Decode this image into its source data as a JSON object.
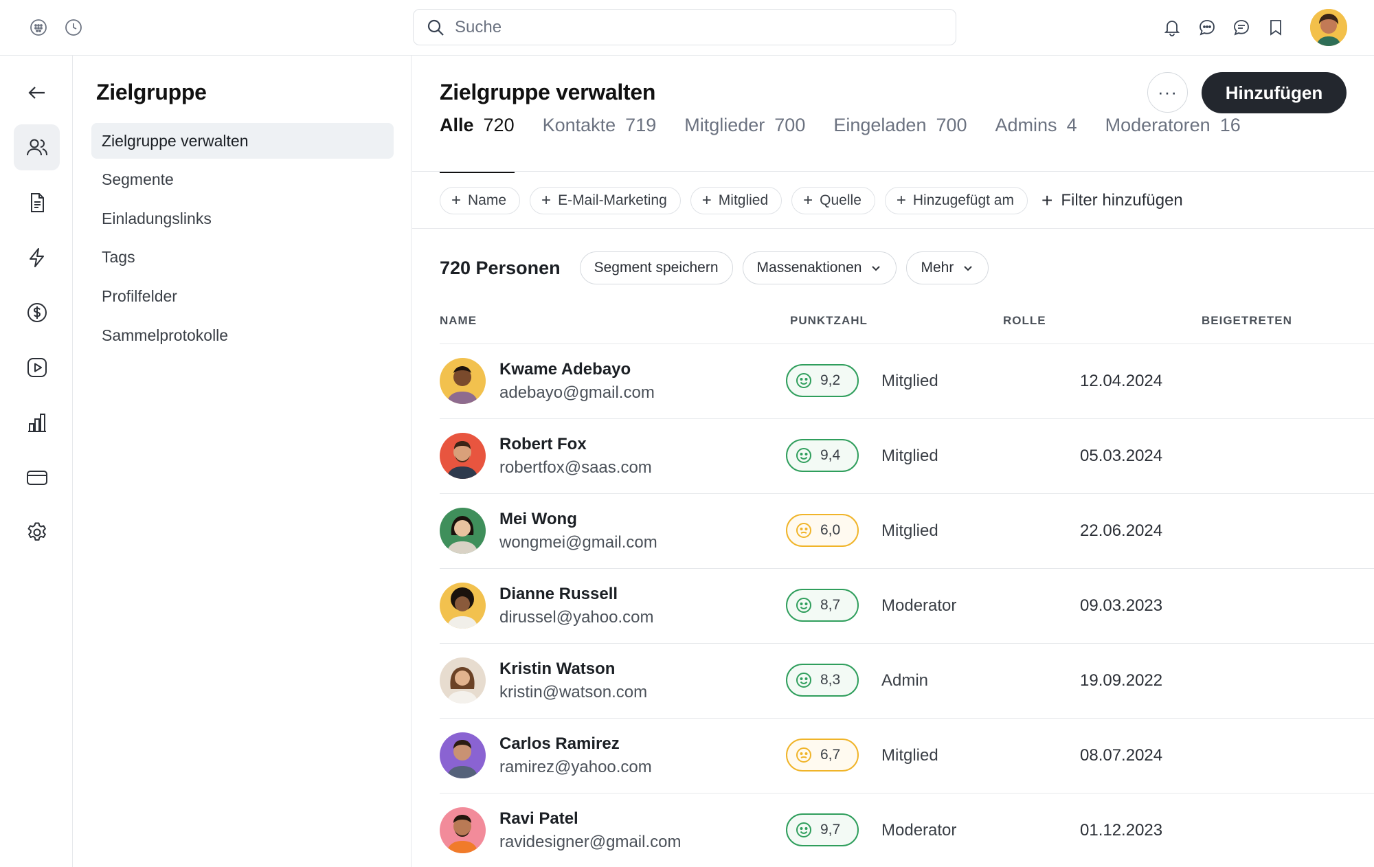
{
  "topbar": {
    "search_placeholder": "Suche",
    "left_icons": [
      "apps-icon",
      "history-icon"
    ],
    "right_icons": [
      "bell-icon",
      "chat-icon",
      "messages-icon",
      "bookmark-icon"
    ]
  },
  "rail": {
    "items": [
      "back-arrow-icon",
      "audience-icon",
      "document-icon",
      "lightning-icon",
      "dollar-icon",
      "video-icon",
      "chart-icon",
      "card-icon",
      "settings-icon"
    ],
    "active": "audience-icon"
  },
  "sidebar": {
    "title": "Zielgruppe",
    "items": [
      {
        "label": "Zielgruppe verwalten",
        "active": true
      },
      {
        "label": "Segmente"
      },
      {
        "label": "Einladungslinks"
      },
      {
        "label": "Tags"
      },
      {
        "label": "Profilfelder"
      },
      {
        "label": "Sammelprotokolle"
      }
    ]
  },
  "main": {
    "title": "Zielgruppe verwalten",
    "more_label": "···",
    "add_label": "Hinzufügen",
    "tabs": [
      {
        "label": "Alle",
        "count": "720",
        "active": true
      },
      {
        "label": "Kontakte",
        "count": "719"
      },
      {
        "label": "Mitglieder",
        "count": "700"
      },
      {
        "label": "Eingeladen",
        "count": "700"
      },
      {
        "label": "Admins",
        "count": "4"
      },
      {
        "label": "Moderatoren",
        "count": "16"
      }
    ],
    "filters": [
      "Name",
      "E-Mail-Marketing",
      "Mitglied",
      "Quelle",
      "Hinzugefügt am"
    ],
    "add_filter_label": "Filter hinzufügen",
    "people_count": "720 Personen",
    "actions": {
      "save_segment": "Segment speichern",
      "bulk": "Massenaktionen",
      "more": "Mehr"
    },
    "columns": {
      "name": "NAME",
      "score": "PUNKTZAHL",
      "role": "ROLLE",
      "joined": "BEIGETRETEN"
    },
    "rows": [
      {
        "name": "Kwame Adebayo",
        "email": "adebayo@gmail.com",
        "score": "9,2",
        "score_level": "good",
        "role": "Mitglied",
        "joined": "12.04.2024",
        "avatar_bg": "#f2c14e"
      },
      {
        "name": "Robert Fox",
        "email": "robertfox@saas.com",
        "score": "9,4",
        "score_level": "good",
        "role": "Mitglied",
        "joined": "05.03.2024",
        "avatar_bg": "#e8553f"
      },
      {
        "name": "Mei Wong",
        "email": "wongmei@gmail.com",
        "score": "6,0",
        "score_level": "mid",
        "role": "Mitglied",
        "joined": "22.06.2024",
        "avatar_bg": "#3f8f5b"
      },
      {
        "name": "Dianne Russell",
        "email": "dirussel@yahoo.com",
        "score": "8,7",
        "score_level": "good",
        "role": "Moderator",
        "joined": "09.03.2023",
        "avatar_bg": "#f2c14e"
      },
      {
        "name": "Kristin Watson",
        "email": "kristin@watson.com",
        "score": "8,3",
        "score_level": "good",
        "role": "Admin",
        "joined": "19.09.2022",
        "avatar_bg": "#e7dccf"
      },
      {
        "name": "Carlos Ramirez",
        "email": "ramirez@yahoo.com",
        "score": "6,7",
        "score_level": "mid",
        "role": "Mitglied",
        "joined": "08.07.2024",
        "avatar_bg": "#8a63d2"
      },
      {
        "name": "Ravi Patel",
        "email": "ravidesigner@gmail.com",
        "score": "9,7",
        "score_level": "good",
        "role": "Moderator",
        "joined": "01.12.2023",
        "avatar_bg": "#f28b9a"
      }
    ]
  },
  "colors": {
    "good": "#2f9e5c",
    "mid": "#f0b429",
    "primary_button": "#23272e"
  }
}
